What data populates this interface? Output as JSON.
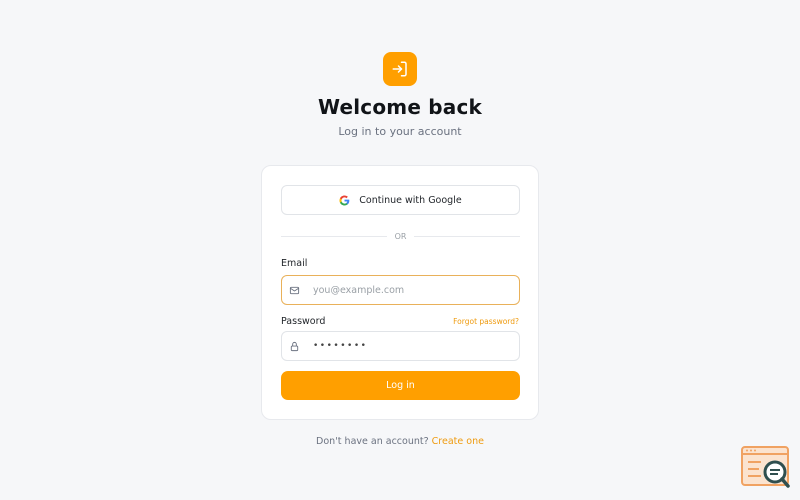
{
  "header": {
    "logo_icon": "login-arrow-icon",
    "title": "Welcome back",
    "subtitle": "Log in to your account"
  },
  "card": {
    "google_button_label": "Continue with Google",
    "divider_label": "OR",
    "email": {
      "label": "Email",
      "placeholder": "you@example.com",
      "value": "",
      "icon": "mail-icon"
    },
    "password": {
      "label": "Password",
      "forgot_label": "Forgot password?",
      "value_masked": "••••••••",
      "icon": "lock-icon"
    },
    "login_button_label": "Log in"
  },
  "footer": {
    "prompt": "Don't have an account?",
    "link_label": "Create one"
  },
  "colors": {
    "accent": "#ff9f00",
    "link": "#ef9b0f",
    "background": "#f6f7f9"
  }
}
